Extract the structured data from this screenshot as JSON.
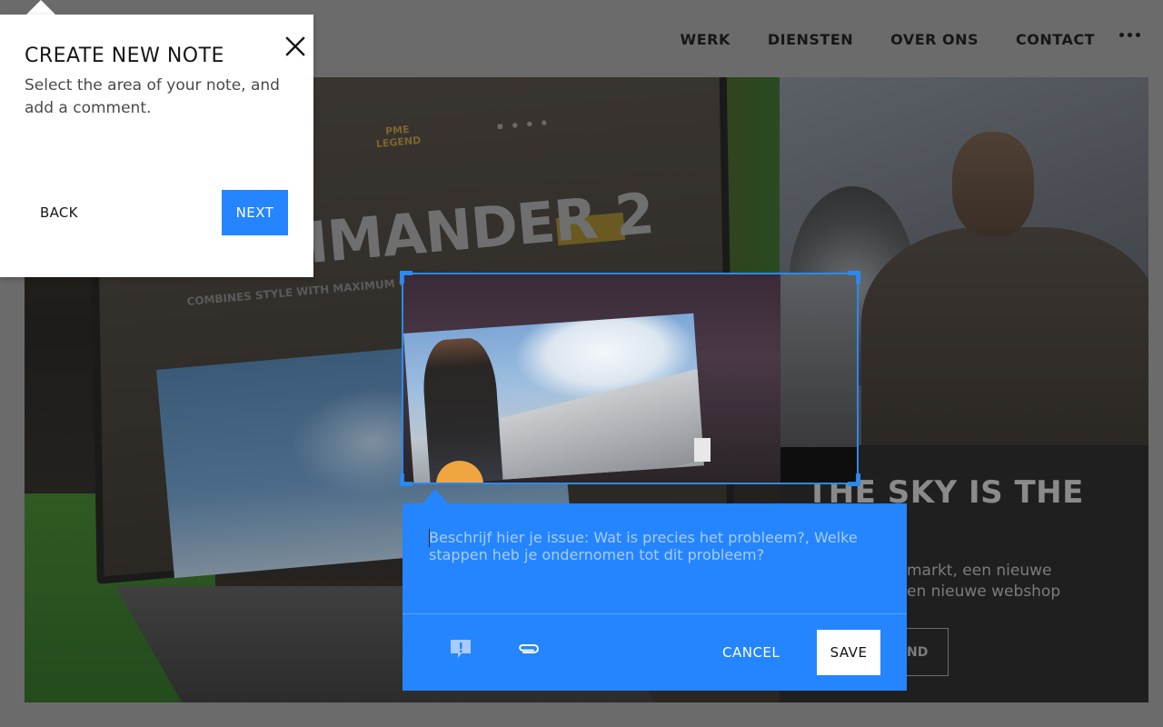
{
  "nav": {
    "items": [
      "WERK",
      "DIENSTEN",
      "OVER ONS",
      "CONTACT"
    ],
    "more_icon": "ellipsis-icon"
  },
  "site": {
    "hero_left": {
      "logo": "PME LEGEND",
      "headline": "COMMANDER 2",
      "subline": "COMBINES STYLE WITH MAXIMUM COMFORT"
    },
    "hero_right": {
      "title": "THE SKY IS THE",
      "body_line1": "markt, een nieuwe",
      "body_line2": "en nieuwe webshop",
      "button_label": "ND"
    }
  },
  "popover": {
    "title": "CREATE NEW NOTE",
    "description": "Select the area of your note, and add a comment.",
    "back_label": "BACK",
    "next_label": "NEXT",
    "close_icon": "close-icon"
  },
  "comment": {
    "placeholder": "Beschrijf hier je issue: Wat is precies het probleem?, Welke stappen heb je ondernomen tot dit probleem?",
    "value": "",
    "priority_icon": "flag-message-icon",
    "attach_icon": "paperclip-icon",
    "cancel_label": "CANCEL",
    "save_label": "SAVE"
  },
  "colors": {
    "accent": "#2485ff",
    "selection_border": "#2a8af0",
    "overlay": "#6b6b6b"
  }
}
